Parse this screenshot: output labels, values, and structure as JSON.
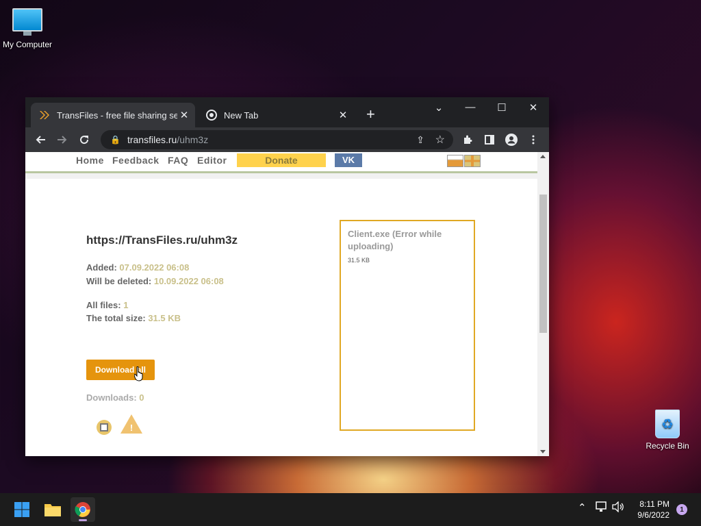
{
  "desktop": {
    "icons": [
      {
        "label": "My Computer"
      },
      {
        "label": "Recycle Bin"
      }
    ]
  },
  "browser": {
    "tabs": [
      {
        "title": "TransFiles - free file sharing servic",
        "active": true,
        "favicon": "transfiles-logo-icon"
      },
      {
        "title": "New Tab",
        "active": false,
        "favicon": "chrome-icon"
      }
    ],
    "new_tab_symbol": "+",
    "close_symbol": "✕",
    "window_controls": {
      "tab_search": "⌄",
      "minimize": "—",
      "maximize": "☐",
      "close": "✕"
    },
    "url": {
      "host": "transfiles.ru",
      "path": "/uhm3z"
    }
  },
  "site": {
    "nav": [
      {
        "label": "Home"
      },
      {
        "label": "Feedback"
      },
      {
        "label": "FAQ"
      },
      {
        "label": "Editor"
      }
    ],
    "donate_label": "Donate",
    "vk_label": "VK",
    "share_url": "https://TransFiles.ru/uhm3z",
    "added_label": "Added:",
    "added_value": "07.09.2022 06:08",
    "deleted_label": "Will be deleted:",
    "deleted_value": "10.09.2022 06:08",
    "files_label": "All files:",
    "files_value": "1",
    "size_label": "The total size:",
    "size_value": "31.5 KB",
    "download_label": "Download all",
    "downloads_label": "Downloads:",
    "downloads_value": "0",
    "file": {
      "name": "Client.exe (Error while uploading)",
      "size": "31.5 KB"
    },
    "colors": {
      "accent": "#e5940d",
      "card_border": "#e0a823",
      "value_text": "#c9c08a",
      "donate": "#ffd24c",
      "vk": "#5b7aa8"
    }
  },
  "taskbar": {
    "time": "8:11 PM",
    "date": "9/6/2022",
    "notification_count": "1"
  }
}
